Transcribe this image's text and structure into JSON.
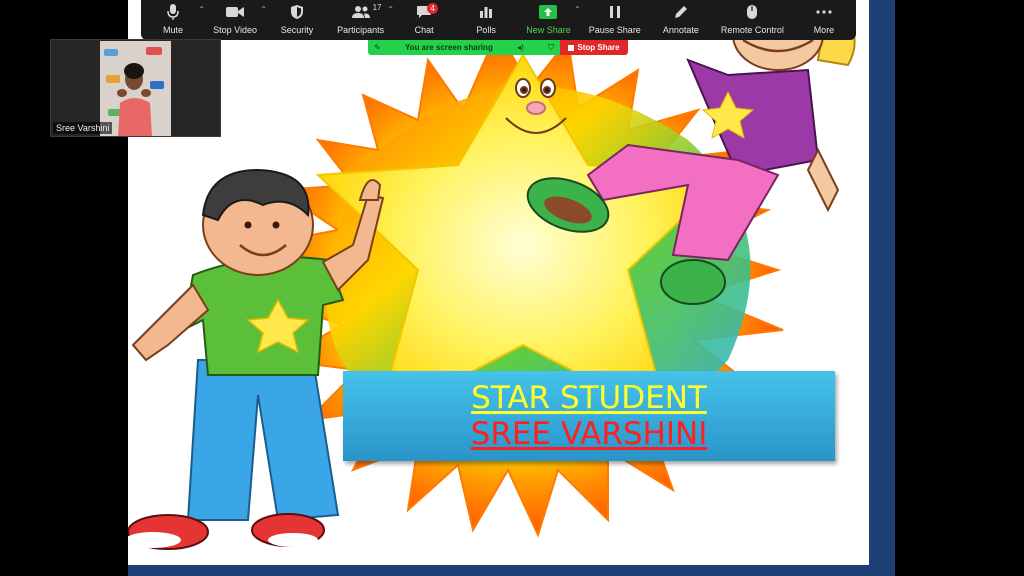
{
  "toolbar": {
    "buttons": [
      {
        "label": "Mute",
        "icon": "microphone-icon"
      },
      {
        "label": "Stop Video",
        "icon": "video-camera-icon"
      },
      {
        "label": "Security",
        "icon": "shield-icon"
      },
      {
        "label": "Participants",
        "icon": "participants-icon",
        "count": "17"
      },
      {
        "label": "Chat",
        "icon": "chat-icon",
        "badge": "4"
      },
      {
        "label": "Polls",
        "icon": "polls-icon"
      },
      {
        "label": "New Share",
        "icon": "new-share-icon"
      },
      {
        "label": "Pause Share",
        "icon": "pause-icon"
      },
      {
        "label": "Annotate",
        "icon": "pencil-icon"
      },
      {
        "label": "Remote Control",
        "icon": "mouse-icon"
      },
      {
        "label": "More",
        "icon": "more-icon"
      }
    ]
  },
  "share_bar": {
    "status_text": "You are screen sharing",
    "stop_label": "Stop Share"
  },
  "video": {
    "participant_name": "Sree Varshini"
  },
  "slide": {
    "line1": "STAR STUDENT",
    "line2": "SREE VARSHINI"
  },
  "colors": {
    "toolbar_bg": "#1a1a1a",
    "share_green": "#23d24a",
    "stop_red": "#e02828",
    "caption_bg": "#3ab2e0",
    "caption_line1": "#ffff2a",
    "caption_line2": "#ff1f1f",
    "slide_border": "#1e3f73"
  }
}
